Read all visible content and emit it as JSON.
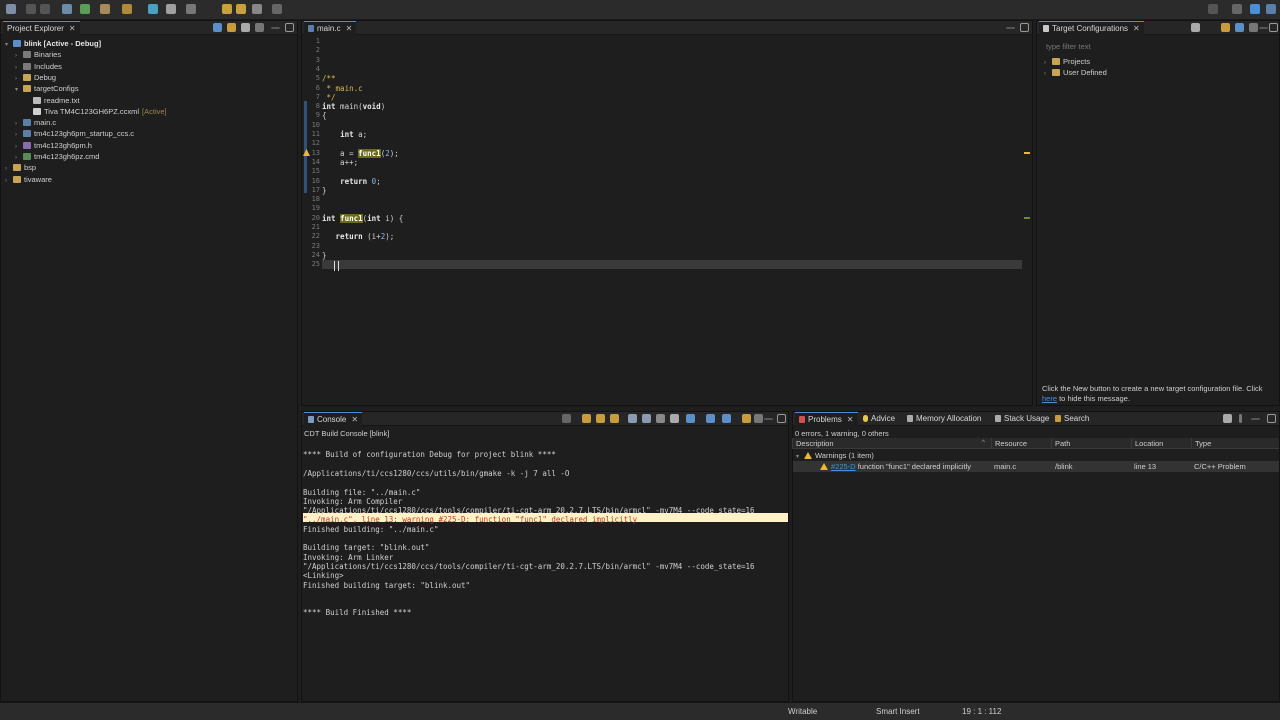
{
  "explorer": {
    "title": "Project Explorer",
    "items": [
      {
        "label": "blink  [Active - Debug]",
        "indent": 0,
        "arrow": "▾"
      },
      {
        "label": "Binaries",
        "indent": 1,
        "arrow": "›"
      },
      {
        "label": "Includes",
        "indent": 1,
        "arrow": "›"
      },
      {
        "label": "Debug",
        "indent": 1,
        "arrow": "›"
      },
      {
        "label": "targetConfigs",
        "indent": 1,
        "arrow": "▾"
      },
      {
        "label": "readme.txt",
        "indent": 2,
        "arrow": ""
      },
      {
        "label": "Tiva TM4C123GH6PZ.ccxml",
        "indent": 2,
        "arrow": "",
        "suffix": "[Active]"
      },
      {
        "label": "main.c",
        "indent": 1,
        "arrow": "›"
      },
      {
        "label": "tm4c123gh6pm_startup_ccs.c",
        "indent": 1,
        "arrow": "›"
      },
      {
        "label": "tm4c123gh6pm.h",
        "indent": 1,
        "arrow": "›"
      },
      {
        "label": "tm4c123gh6pz.cmd",
        "indent": 1,
        "arrow": "›"
      },
      {
        "label": "bsp",
        "indent": 0,
        "arrow": "›"
      },
      {
        "label": "tivaware",
        "indent": 0,
        "arrow": "›"
      }
    ]
  },
  "editor": {
    "tab": "main.c",
    "lines": [
      {
        "n": "1",
        "t": ""
      },
      {
        "n": "2",
        "t": ""
      },
      {
        "n": "3",
        "t": ""
      },
      {
        "n": "4",
        "t": ""
      },
      {
        "n": "5",
        "t": "/**"
      },
      {
        "n": "6",
        "t": " * main.c"
      },
      {
        "n": "7",
        "t": " */"
      },
      {
        "n": "8",
        "t": "int main(void)"
      },
      {
        "n": "9",
        "t": "{"
      },
      {
        "n": "10",
        "t": ""
      },
      {
        "n": "11",
        "t": "    int a;"
      },
      {
        "n": "12",
        "t": ""
      },
      {
        "n": "13",
        "t": "    a = func1(2);"
      },
      {
        "n": "14",
        "t": "    a++;"
      },
      {
        "n": "15",
        "t": ""
      },
      {
        "n": "16",
        "t": "    return 0;"
      },
      {
        "n": "17",
        "t": "}"
      },
      {
        "n": "18",
        "t": ""
      },
      {
        "n": "19",
        "t": ""
      },
      {
        "n": "20",
        "t": "int func1(int i) {"
      },
      {
        "n": "21",
        "t": ""
      },
      {
        "n": "22",
        "t": "   return (i+2);"
      },
      {
        "n": "23",
        "t": ""
      },
      {
        "n": "24",
        "t": "}"
      },
      {
        "n": "25",
        "t": ""
      }
    ]
  },
  "target": {
    "title": "Target Configurations",
    "filter_placeholder": "type filter text",
    "items": [
      "Projects",
      "User Defined"
    ],
    "message_a": "Click the New button to create a new target configuration file. Click",
    "message_link": "here",
    "message_b": " to hide this message."
  },
  "console": {
    "title": "Console",
    "header": "CDT Build Console [blink]",
    "lines": [
      "",
      "**** Build of configuration Debug for project blink ****",
      "",
      "/Applications/ti/ccs1280/ccs/utils/bin/gmake -k -j 7 all -O",
      "",
      "Building file: \"../main.c\"",
      "Invoking: Arm Compiler",
      "\"/Applications/ti/ccs1280/ccs/tools/compiler/ti-cgt-arm_20.2.7.LTS/bin/armcl\" -mv7M4 --code_state=16",
      "\"../main.c\", line 13: warning #225-D: function \"func1\" declared implicitly",
      "Finished building: \"../main.c\"",
      "",
      "Building target: \"blink.out\"",
      "Invoking: Arm Linker",
      "\"/Applications/ti/ccs1280/ccs/tools/compiler/ti-cgt-arm_20.2.7.LTS/bin/armcl\" -mv7M4 --code_state=16",
      "<Linking>",
      "Finished building target: \"blink.out\"",
      "",
      "",
      "**** Build Finished ****"
    ]
  },
  "problems": {
    "tabs": [
      "Problems",
      "Advice",
      "Memory Allocation",
      "Stack Usage",
      "Search"
    ],
    "summary": "0 errors, 1 warning, 0 others",
    "columns": [
      "Description",
      "Resource",
      "Path",
      "Location",
      "Type"
    ],
    "group": "Warnings (1 item)",
    "row": {
      "code": "#225-D",
      "description": "function \"func1\" declared implicitly",
      "resource": "main.c",
      "path": "/blink",
      "location": "line 13",
      "type": "C/C++ Problem"
    }
  },
  "status": {
    "writable": "Writable",
    "insert": "Smart Insert",
    "position": "19 : 1 : 112"
  },
  "colors": {
    "accent": "#4a90d9",
    "warning": "#e8b931",
    "link": "#4a90d9"
  }
}
